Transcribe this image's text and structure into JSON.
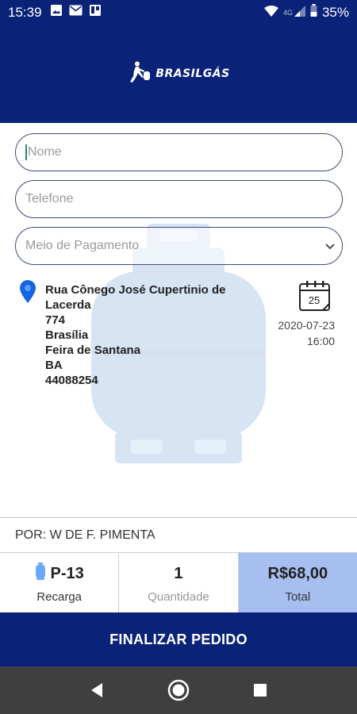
{
  "status_bar": {
    "time": "15:39",
    "left_icons": [
      "image-icon",
      "mail-icon",
      "board-icon"
    ],
    "network_label": "4G",
    "battery_percent": "35%"
  },
  "header": {
    "brand": "BRASILGÁS"
  },
  "form": {
    "name_placeholder": "Nome",
    "phone_placeholder": "Telefone",
    "payment_placeholder": "Meio de Pagamento"
  },
  "address": {
    "lines": [
      "Rua Cônego José Cupertinio de",
      "Lacerda",
      "774",
      "Brasília",
      "Feira de Santana",
      "BA",
      "44088254"
    ]
  },
  "delivery": {
    "calendar_day": "25",
    "date": "2020-07-23",
    "time": "16:00"
  },
  "seller": {
    "label": "POR: W DE F. PIMENTA"
  },
  "summary": {
    "product_code": "P-13",
    "product_type": "Recarga",
    "quantity": "1",
    "quantity_label": "Quantidade",
    "total": "R$68,00",
    "total_label": "Total"
  },
  "actions": {
    "finalize_label": "FINALIZAR PEDIDO"
  },
  "colors": {
    "brand_blue": "#0a2378",
    "total_bg": "#a6bff0",
    "pin_blue": "#1565e0"
  }
}
